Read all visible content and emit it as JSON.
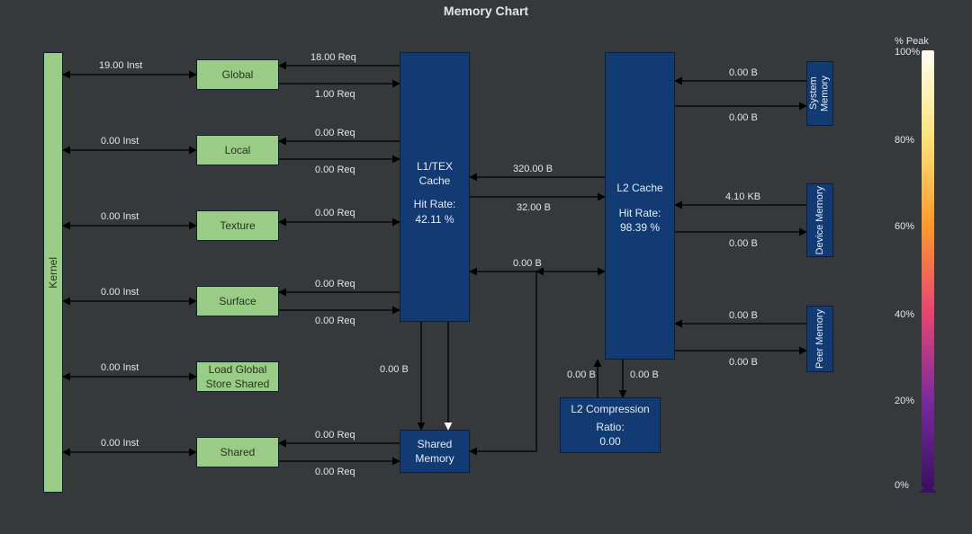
{
  "title": "Memory Chart",
  "blocks": {
    "kernel": "Kernel",
    "global": "Global",
    "local": "Local",
    "texture": "Texture",
    "surface": "Surface",
    "lgss": "Load Global\nStore Shared",
    "shared": "Shared",
    "l1": {
      "name": "L1/TEX\nCache",
      "hit": "Hit Rate:\n42.11 %"
    },
    "sharedMem": "Shared\nMemory",
    "l2": {
      "name": "L2 Cache",
      "hit": "Hit Rate:\n98.39 %"
    },
    "l2comp": {
      "name": "L2 Compression",
      "ratio": "Ratio:\n0.00"
    },
    "sysmem": "System\nMemory",
    "devmem": "Device\nMemory",
    "peermem": "Peer\nMemory"
  },
  "edges": {
    "k_global": "19.00 Inst",
    "k_local": "0.00 Inst",
    "k_texture": "0.00 Inst",
    "k_surface": "0.00 Inst",
    "k_lgss": "0.00 Inst",
    "k_shared": "0.00 Inst",
    "global_l1_t": "18.00 Req",
    "global_l1_b": "1.00 Req",
    "local_l1_t": "0.00 Req",
    "local_l1_b": "0.00 Req",
    "texture_l1": "0.00 Req",
    "surface_l1_t": "0.00 Req",
    "surface_l1_b": "0.00 Req",
    "shared_l1_t": "0.00 Req",
    "shared_l1_b": "0.00 Req",
    "l1_shared_b": "0.00 B",
    "l1_l2_t": "320.00 B",
    "l1_l2_b": "32.00 B",
    "shared_l2": "0.00 B",
    "comp_l2_l": "0.00 B",
    "comp_l2_r": "0.00 B",
    "l2_sys_t": "0.00 B",
    "l2_sys_b": "0.00 B",
    "l2_dev_t": "4.10 KB",
    "l2_dev_b": "0.00 B",
    "l2_peer_t": "0.00 B",
    "l2_peer_b": "0.00 B"
  },
  "scale": {
    "label": "% Peak",
    "t100": "100%",
    "t80": "80%",
    "t60": "60%",
    "t40": "40%",
    "t20": "20%",
    "t0": "0%"
  }
}
